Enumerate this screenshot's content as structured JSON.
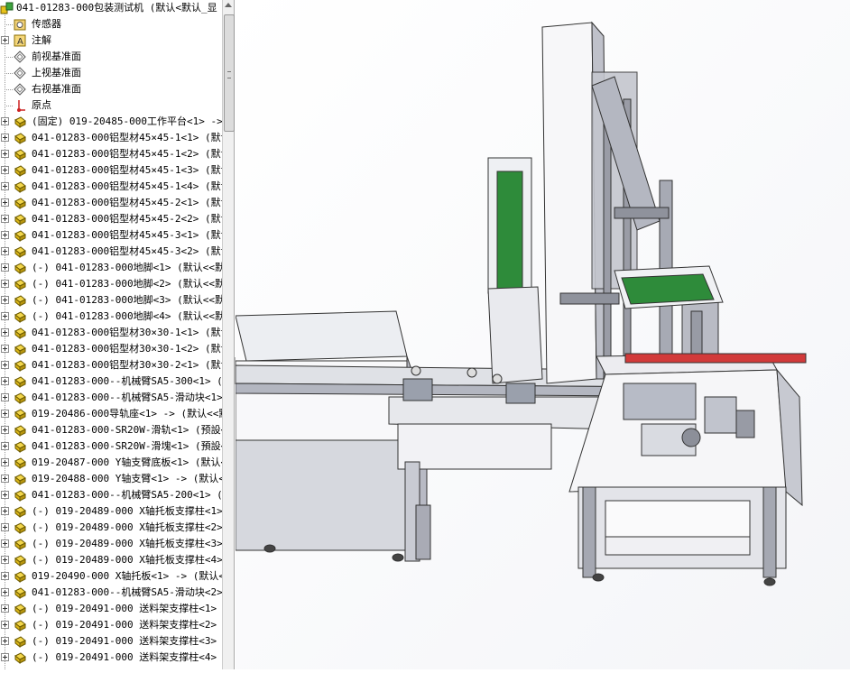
{
  "feature_tree": {
    "root_label": "041-01283-000包装测试机  (默认<默认_显",
    "items": [
      {
        "label": "传感器",
        "icon": "sensor-folder-icon",
        "expand": false
      },
      {
        "label": "注解",
        "icon": "annotation-icon",
        "expand": true
      },
      {
        "label": "前视基准面",
        "icon": "plane-icon",
        "expand": false
      },
      {
        "label": "上视基准面",
        "icon": "plane-icon",
        "expand": false
      },
      {
        "label": "右视基准面",
        "icon": "plane-icon",
        "expand": false
      },
      {
        "label": "原点",
        "icon": "origin-icon",
        "expand": false
      },
      {
        "label": "(固定) 019-20485-000工作平台<1> ->",
        "icon": "part-icon",
        "expand": true
      },
      {
        "label": "041-01283-000铝型材45×45-1<1> (默认",
        "icon": "part-icon",
        "expand": true
      },
      {
        "label": "041-01283-000铝型材45×45-1<2> (默认",
        "icon": "part-icon",
        "expand": true
      },
      {
        "label": "041-01283-000铝型材45×45-1<3> (默认",
        "icon": "part-icon",
        "expand": true
      },
      {
        "label": "041-01283-000铝型材45×45-1<4> (默认",
        "icon": "part-icon",
        "expand": true
      },
      {
        "label": "041-01283-000铝型材45×45-2<1> (默认",
        "icon": "part-icon",
        "expand": true
      },
      {
        "label": "041-01283-000铝型材45×45-2<2> (默认",
        "icon": "part-icon",
        "expand": true
      },
      {
        "label": "041-01283-000铝型材45×45-3<1> (默认",
        "icon": "part-icon",
        "expand": true
      },
      {
        "label": "041-01283-000铝型材45×45-3<2> (默认",
        "icon": "part-icon",
        "expand": true
      },
      {
        "label": "(-) 041-01283-000地脚<1> (默认<<默认",
        "icon": "part-icon",
        "expand": true
      },
      {
        "label": "(-) 041-01283-000地脚<2> (默认<<默认",
        "icon": "part-icon",
        "expand": true
      },
      {
        "label": "(-) 041-01283-000地脚<3> (默认<<默认",
        "icon": "part-icon",
        "expand": true
      },
      {
        "label": "(-) 041-01283-000地脚<4> (默认<<默认",
        "icon": "part-icon",
        "expand": true
      },
      {
        "label": "041-01283-000铝型材30×30-1<1> (默认",
        "icon": "part-icon",
        "expand": true
      },
      {
        "label": "041-01283-000铝型材30×30-1<2> (默认",
        "icon": "part-icon",
        "expand": true
      },
      {
        "label": "041-01283-000铝型材30×30-2<1> (默认",
        "icon": "part-icon",
        "expand": true
      },
      {
        "label": "041-01283-000--机械臂SA5-300<1> (默认",
        "icon": "part-icon",
        "expand": true
      },
      {
        "label": "041-01283-000--机械臂SA5-滑动块<1>",
        "icon": "part-icon",
        "expand": true
      },
      {
        "label": "019-20486-000导轨座<1> -> (默认<<默",
        "icon": "part-icon",
        "expand": true
      },
      {
        "label": "041-01283-000-SR20W-滑轨<1> (预設<<",
        "icon": "part-icon",
        "expand": true
      },
      {
        "label": "041-01283-000-SR20W-滑塊<1> (預設<<",
        "icon": "part-icon",
        "expand": true
      },
      {
        "label": "019-20487-000 Y轴支臂底板<1> (默认<<",
        "icon": "part-icon",
        "expand": true
      },
      {
        "label": "019-20488-000 Y轴支臂<1> -> (默认<<",
        "icon": "part-icon",
        "expand": true
      },
      {
        "label": "041-01283-000--机械臂SA5-200<1> (默",
        "icon": "part-icon",
        "expand": true
      },
      {
        "label": "(-) 019-20489-000 X轴托板支撑柱<1> (",
        "icon": "part-icon",
        "expand": true
      },
      {
        "label": "(-) 019-20489-000 X轴托板支撑柱<2> (",
        "icon": "part-icon",
        "expand": true
      },
      {
        "label": "(-) 019-20489-000 X轴托板支撑柱<3> (",
        "icon": "part-icon",
        "expand": true
      },
      {
        "label": "(-) 019-20489-000 X轴托板支撑柱<4> (",
        "icon": "part-icon",
        "expand": true
      },
      {
        "label": "019-20490-000 X轴托板<1> -> (默认<<",
        "icon": "part-icon",
        "expand": true
      },
      {
        "label": "041-01283-000--机械臂SA5-滑动块<2>",
        "icon": "part-icon",
        "expand": true
      },
      {
        "label": "(-) 019-20491-000 送料架支撑柱<1> (",
        "icon": "part-icon",
        "expand": true
      },
      {
        "label": "(-) 019-20491-000 送料架支撑柱<2> (",
        "icon": "part-icon",
        "expand": true
      },
      {
        "label": "(-) 019-20491-000 送料架支撑柱<3> (",
        "icon": "part-icon",
        "expand": true
      },
      {
        "label": "(-) 019-20491-000 送料架支撑柱<4> (",
        "icon": "part-icon",
        "expand": true
      }
    ]
  },
  "colors": {
    "part_icon": "#e8c21a",
    "panel_green": "#2e8b3a",
    "frame_gray": "#a9a9b3",
    "red_strip": "#d23a3a"
  }
}
